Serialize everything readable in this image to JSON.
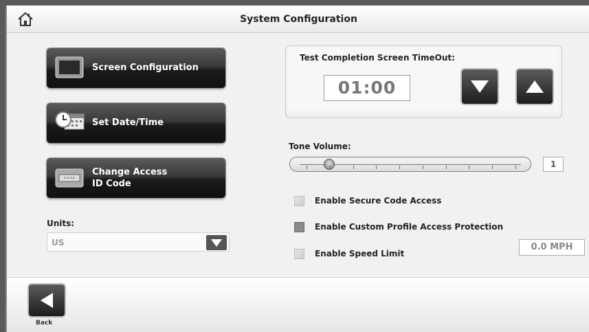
{
  "header": {
    "title": "System Configuration",
    "home_icon": "home-icon"
  },
  "left_buttons": [
    {
      "label": "Screen Configuration",
      "icon": "monitor-icon"
    },
    {
      "label": "Set Date/Time",
      "icon": "clock-calendar-icon"
    },
    {
      "label_line1": "Change Access",
      "label_line2": "ID Code",
      "icon": "keypad-icon"
    }
  ],
  "units": {
    "label": "Units:",
    "value": "US"
  },
  "timeout": {
    "label": "Test Completion Screen TimeOut:",
    "value": "01:00"
  },
  "tone": {
    "label": "Tone Volume:",
    "value": "1",
    "level_fraction": 0.11,
    "tick_count": 10
  },
  "checkboxes": [
    {
      "label": "Enable Secure Code Access",
      "checked": false
    },
    {
      "label": "Enable Custom Profile Access Protection",
      "checked": true
    },
    {
      "label": "Enable Speed Limit",
      "checked": false
    }
  ],
  "speed_limit": {
    "value": "0.0 MPH"
  },
  "footer": {
    "back_label": "Back"
  },
  "colors": {
    "button_dark": "#1d1d1d",
    "background": "#f1f1f1",
    "checkbox_checked": "#8a8a8a"
  }
}
